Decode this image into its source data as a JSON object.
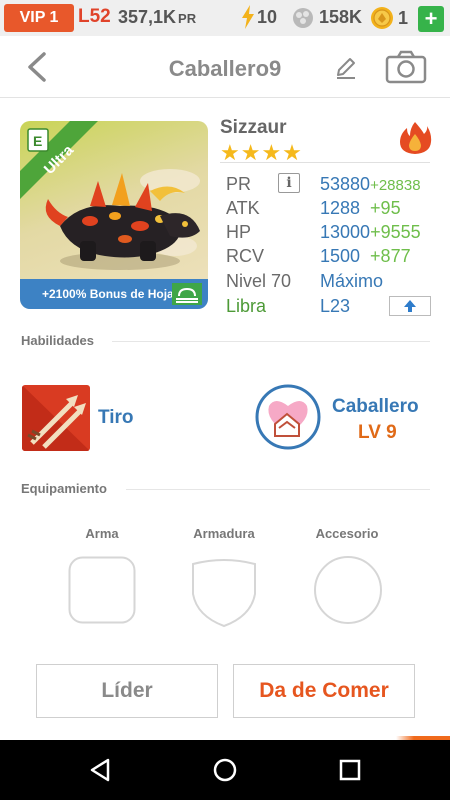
{
  "status": {
    "vip": "VIP 1",
    "level": "L52",
    "power": "357,1K",
    "power_unit": "PR",
    "energy": "10",
    "food": "158K",
    "gems": "1",
    "add": "+"
  },
  "header": {
    "title": "Caballero9",
    "back_icon": "chevron-left-icon",
    "edit_icon": "pencil-icon",
    "camera_icon": "camera-icon"
  },
  "monster": {
    "name": "Sizzaur",
    "stars": "★★★★",
    "rarity": "Ultra",
    "bonus_text": "+2100% Bonus de Hoja",
    "element_icon": "fire-icon",
    "stats": [
      {
        "label": "PR",
        "value": "53880",
        "bonus": "+28838"
      },
      {
        "label": "ATK",
        "value": "1288",
        "bonus": "+95"
      },
      {
        "label": "HP",
        "value": "13000",
        "bonus": "+9555"
      },
      {
        "label": "RCV",
        "value": "1500",
        "bonus": "+877"
      }
    ],
    "level_label": "Nivel 70",
    "level_value": "Máximo",
    "sign_label": "Libra",
    "sign_value": "L23",
    "info_glyph": "i"
  },
  "skills": {
    "section_title": "Habilidades",
    "ability": {
      "name": "Tiro"
    },
    "leader": {
      "name": "Caballero",
      "level": "LV 9"
    }
  },
  "equipment": {
    "section_title": "Equipamiento",
    "slots": [
      {
        "label": "Arma"
      },
      {
        "label": "Armadura"
      },
      {
        "label": "Accesorio"
      }
    ]
  },
  "actions": {
    "leader_button": "Líder",
    "feed_button": "Da de Comer"
  },
  "colors": {
    "accent_orange": "#e6561f",
    "stat_blue": "#3778b5",
    "bonus_green": "#6fbe4b",
    "star_gold": "#f5b91c"
  }
}
